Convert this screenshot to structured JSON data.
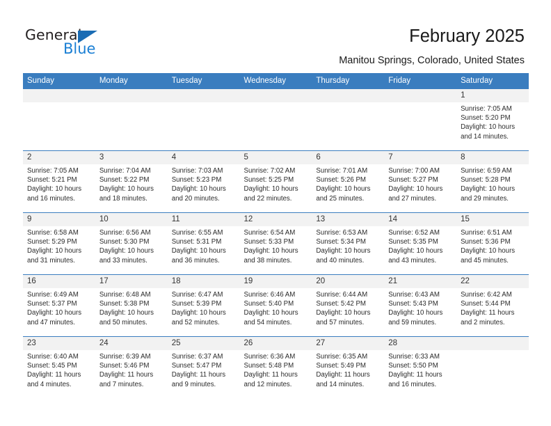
{
  "brand": {
    "name_dark": "General",
    "name_blue": "Blue",
    "accent_color": "#1a7fd4",
    "triangle_color": "#1a6cb4"
  },
  "header": {
    "title": "February 2025",
    "subtitle": "Manitou Springs, Colorado, United States",
    "header_bg_color": "#3a7dbf",
    "day_cell_bg_color": "#f2f2f2"
  },
  "weekday_headers": [
    "Sunday",
    "Monday",
    "Tuesday",
    "Wednesday",
    "Thursday",
    "Friday",
    "Saturday"
  ],
  "weeks": [
    [
      {
        "day": "",
        "lines": []
      },
      {
        "day": "",
        "lines": []
      },
      {
        "day": "",
        "lines": []
      },
      {
        "day": "",
        "lines": []
      },
      {
        "day": "",
        "lines": []
      },
      {
        "day": "",
        "lines": []
      },
      {
        "day": "1",
        "lines": [
          "Sunrise: 7:05 AM",
          "Sunset: 5:20 PM",
          "Daylight: 10 hours",
          "and 14 minutes."
        ]
      }
    ],
    [
      {
        "day": "2",
        "lines": [
          "Sunrise: 7:05 AM",
          "Sunset: 5:21 PM",
          "Daylight: 10 hours",
          "and 16 minutes."
        ]
      },
      {
        "day": "3",
        "lines": [
          "Sunrise: 7:04 AM",
          "Sunset: 5:22 PM",
          "Daylight: 10 hours",
          "and 18 minutes."
        ]
      },
      {
        "day": "4",
        "lines": [
          "Sunrise: 7:03 AM",
          "Sunset: 5:23 PM",
          "Daylight: 10 hours",
          "and 20 minutes."
        ]
      },
      {
        "day": "5",
        "lines": [
          "Sunrise: 7:02 AM",
          "Sunset: 5:25 PM",
          "Daylight: 10 hours",
          "and 22 minutes."
        ]
      },
      {
        "day": "6",
        "lines": [
          "Sunrise: 7:01 AM",
          "Sunset: 5:26 PM",
          "Daylight: 10 hours",
          "and 25 minutes."
        ]
      },
      {
        "day": "7",
        "lines": [
          "Sunrise: 7:00 AM",
          "Sunset: 5:27 PM",
          "Daylight: 10 hours",
          "and 27 minutes."
        ]
      },
      {
        "day": "8",
        "lines": [
          "Sunrise: 6:59 AM",
          "Sunset: 5:28 PM",
          "Daylight: 10 hours",
          "and 29 minutes."
        ]
      }
    ],
    [
      {
        "day": "9",
        "lines": [
          "Sunrise: 6:58 AM",
          "Sunset: 5:29 PM",
          "Daylight: 10 hours",
          "and 31 minutes."
        ]
      },
      {
        "day": "10",
        "lines": [
          "Sunrise: 6:56 AM",
          "Sunset: 5:30 PM",
          "Daylight: 10 hours",
          "and 33 minutes."
        ]
      },
      {
        "day": "11",
        "lines": [
          "Sunrise: 6:55 AM",
          "Sunset: 5:31 PM",
          "Daylight: 10 hours",
          "and 36 minutes."
        ]
      },
      {
        "day": "12",
        "lines": [
          "Sunrise: 6:54 AM",
          "Sunset: 5:33 PM",
          "Daylight: 10 hours",
          "and 38 minutes."
        ]
      },
      {
        "day": "13",
        "lines": [
          "Sunrise: 6:53 AM",
          "Sunset: 5:34 PM",
          "Daylight: 10 hours",
          "and 40 minutes."
        ]
      },
      {
        "day": "14",
        "lines": [
          "Sunrise: 6:52 AM",
          "Sunset: 5:35 PM",
          "Daylight: 10 hours",
          "and 43 minutes."
        ]
      },
      {
        "day": "15",
        "lines": [
          "Sunrise: 6:51 AM",
          "Sunset: 5:36 PM",
          "Daylight: 10 hours",
          "and 45 minutes."
        ]
      }
    ],
    [
      {
        "day": "16",
        "lines": [
          "Sunrise: 6:49 AM",
          "Sunset: 5:37 PM",
          "Daylight: 10 hours",
          "and 47 minutes."
        ]
      },
      {
        "day": "17",
        "lines": [
          "Sunrise: 6:48 AM",
          "Sunset: 5:38 PM",
          "Daylight: 10 hours",
          "and 50 minutes."
        ]
      },
      {
        "day": "18",
        "lines": [
          "Sunrise: 6:47 AM",
          "Sunset: 5:39 PM",
          "Daylight: 10 hours",
          "and 52 minutes."
        ]
      },
      {
        "day": "19",
        "lines": [
          "Sunrise: 6:46 AM",
          "Sunset: 5:40 PM",
          "Daylight: 10 hours",
          "and 54 minutes."
        ]
      },
      {
        "day": "20",
        "lines": [
          "Sunrise: 6:44 AM",
          "Sunset: 5:42 PM",
          "Daylight: 10 hours",
          "and 57 minutes."
        ]
      },
      {
        "day": "21",
        "lines": [
          "Sunrise: 6:43 AM",
          "Sunset: 5:43 PM",
          "Daylight: 10 hours",
          "and 59 minutes."
        ]
      },
      {
        "day": "22",
        "lines": [
          "Sunrise: 6:42 AM",
          "Sunset: 5:44 PM",
          "Daylight: 11 hours",
          "and 2 minutes."
        ]
      }
    ],
    [
      {
        "day": "23",
        "lines": [
          "Sunrise: 6:40 AM",
          "Sunset: 5:45 PM",
          "Daylight: 11 hours",
          "and 4 minutes."
        ]
      },
      {
        "day": "24",
        "lines": [
          "Sunrise: 6:39 AM",
          "Sunset: 5:46 PM",
          "Daylight: 11 hours",
          "and 7 minutes."
        ]
      },
      {
        "day": "25",
        "lines": [
          "Sunrise: 6:37 AM",
          "Sunset: 5:47 PM",
          "Daylight: 11 hours",
          "and 9 minutes."
        ]
      },
      {
        "day": "26",
        "lines": [
          "Sunrise: 6:36 AM",
          "Sunset: 5:48 PM",
          "Daylight: 11 hours",
          "and 12 minutes."
        ]
      },
      {
        "day": "27",
        "lines": [
          "Sunrise: 6:35 AM",
          "Sunset: 5:49 PM",
          "Daylight: 11 hours",
          "and 14 minutes."
        ]
      },
      {
        "day": "28",
        "lines": [
          "Sunrise: 6:33 AM",
          "Sunset: 5:50 PM",
          "Daylight: 11 hours",
          "and 16 minutes."
        ]
      },
      {
        "day": "",
        "lines": []
      }
    ]
  ]
}
